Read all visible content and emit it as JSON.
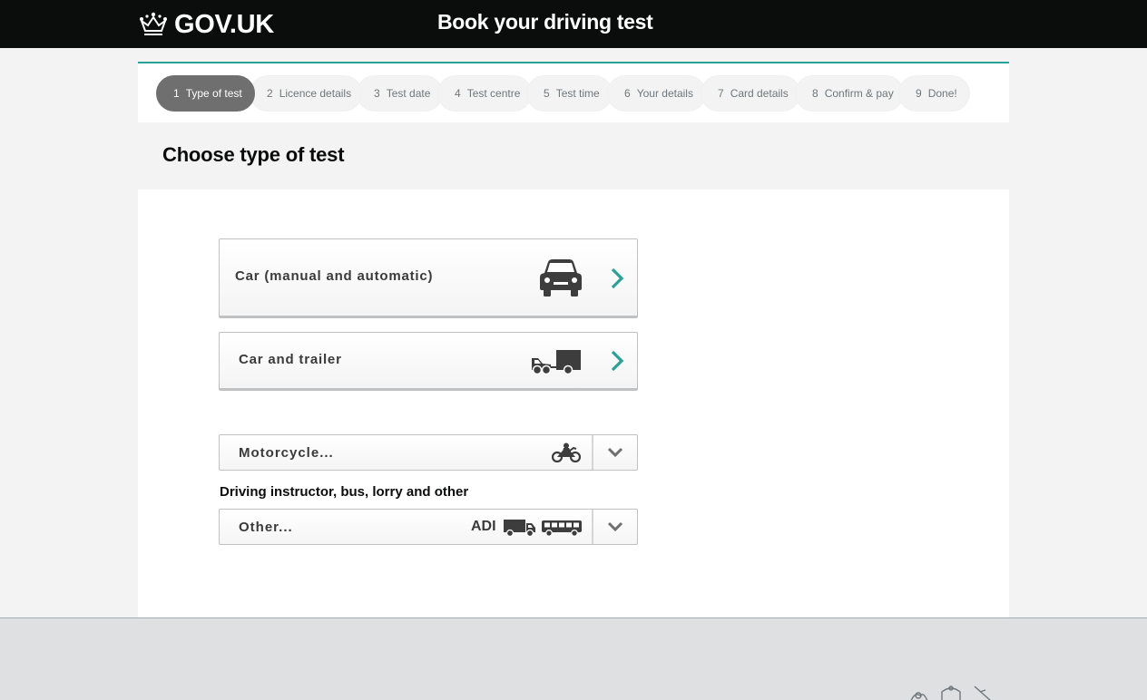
{
  "header": {
    "logo_text": "GOV.UK",
    "service_name": "Book your driving test"
  },
  "steps": [
    {
      "num": "1",
      "label": "Type of test",
      "active": true
    },
    {
      "num": "2",
      "label": "Licence details"
    },
    {
      "num": "3",
      "label": "Test date"
    },
    {
      "num": "4",
      "label": "Test centre"
    },
    {
      "num": "5",
      "label": "Test time"
    },
    {
      "num": "6",
      "label": "Your details"
    },
    {
      "num": "7",
      "label": "Card details"
    },
    {
      "num": "8",
      "label": "Confirm & pay"
    },
    {
      "num": "9",
      "label": "Done!"
    }
  ],
  "page": {
    "title": "Choose type of test"
  },
  "options": {
    "car": {
      "label": "Car (manual and automatic)",
      "icon": "car-icon"
    },
    "trailer": {
      "label": "Car and trailer",
      "icon": "car-trailer-icon"
    }
  },
  "selects": {
    "motorcycle": {
      "label": "Motorcycle...",
      "icon": "motorcycle-icon"
    },
    "other_heading": "Driving instructor, bus, lorry and other",
    "other": {
      "label": "Other...",
      "adi": "ADI",
      "icons": [
        "lorry-icon",
        "bus-icon"
      ]
    }
  },
  "colors": {
    "header_bg": "#0b0c0c",
    "accent": "#28a197",
    "active_step": "#6f6f6f"
  }
}
